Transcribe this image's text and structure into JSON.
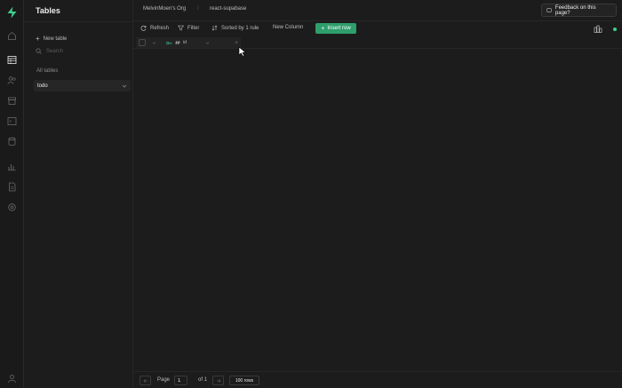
{
  "rail": {
    "items": [
      "home-icon",
      "table-editor-icon",
      "auth-icon",
      "storage-icon",
      "sql-editor-icon",
      "database-icon",
      "reports-icon",
      "api-docs-icon",
      "settings-icon"
    ],
    "active": "table-editor-icon",
    "bottom": "user-icon"
  },
  "panel": {
    "title": "Tables",
    "new_table": "New table",
    "search_placeholder": "Search",
    "section_label": "All tables",
    "tables": [
      {
        "name": "todo"
      }
    ]
  },
  "topbar": {
    "org": "MelvinMoen's Org",
    "separator": "/",
    "project": "react-supabase",
    "feedback": "Feedback on this page?"
  },
  "toolbar": {
    "refresh": "Refresh",
    "filter": "Filter",
    "sort": "Sorted by 1 rule",
    "new_column": "New Column",
    "insert_row": "Insert row"
  },
  "header": {
    "columns": [
      {
        "name": "id",
        "icon": "key-icon"
      }
    ]
  },
  "footer": {
    "page_label": "Page",
    "page_value": "1",
    "of_label": "of 1",
    "rows": "100 rows"
  },
  "colors": {
    "accent": "#3ecf8e",
    "insert_button": "#2e9e6b",
    "background": "#1c1c1c"
  }
}
